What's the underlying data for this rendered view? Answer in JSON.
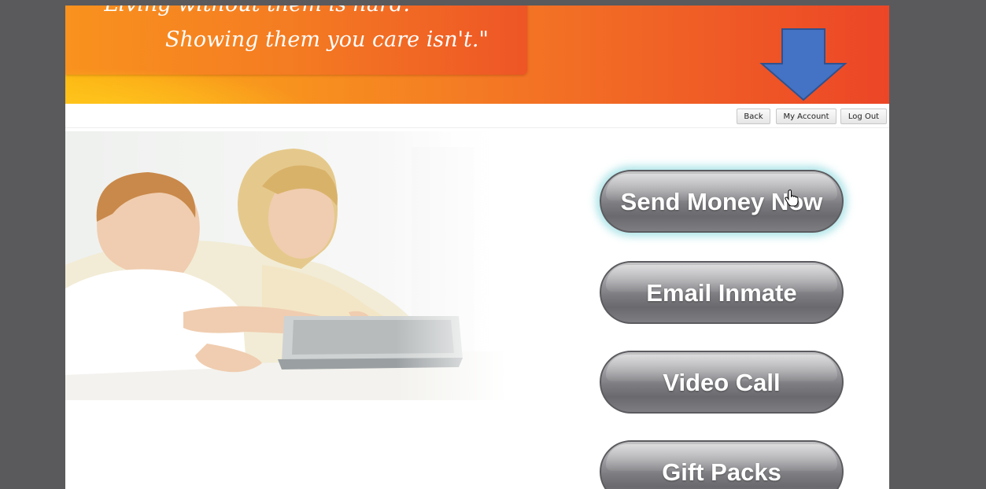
{
  "banner": {
    "quote_line1": "\"Living without them is hard.",
    "quote_line2": "Showing them you care isn't.\"",
    "arrow_color": "#4472c4"
  },
  "toolbar": {
    "back_label": "Back",
    "my_account_label": "My Account",
    "log_out_label": "Log Out"
  },
  "actions": {
    "send_money_label": "Send Money Now",
    "email_inmate_label": "Email Inmate",
    "video_call_label": "Video Call",
    "gift_packs_label": "Gift Packs"
  },
  "colors": {
    "banner_start": "#fdb813",
    "banner_end": "#ec4627",
    "button_gray": "#7c7c80",
    "glow": "#96dce1",
    "frame": "#5a5a5c"
  }
}
